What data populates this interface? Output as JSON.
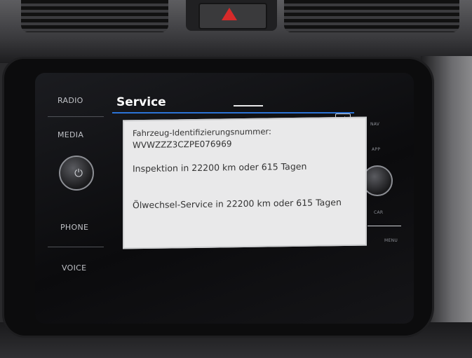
{
  "dashboard": {
    "hazard_icon": "warning-triangle-icon",
    "hazard_color": "#d62a2a"
  },
  "left_buttons": [
    "RADIO",
    "MEDIA",
    "PHONE",
    "VOICE"
  ],
  "right_buttons": [
    "NAV",
    "APP",
    "CAR",
    "MENU"
  ],
  "screen": {
    "title": "Service",
    "back_icon": "back-arrow-icon",
    "accent_color": "#2b73d6"
  },
  "popup": {
    "vin_label": "Fahrzeug-Identifizierungsnummer:",
    "vin_value": "WVWZZZ3CZPE076969",
    "inspection": "Inspektion in 22200 km oder 615 Tagen",
    "oil_service": "Ölwechsel-Service in 22200 km oder 615 Tagen"
  }
}
